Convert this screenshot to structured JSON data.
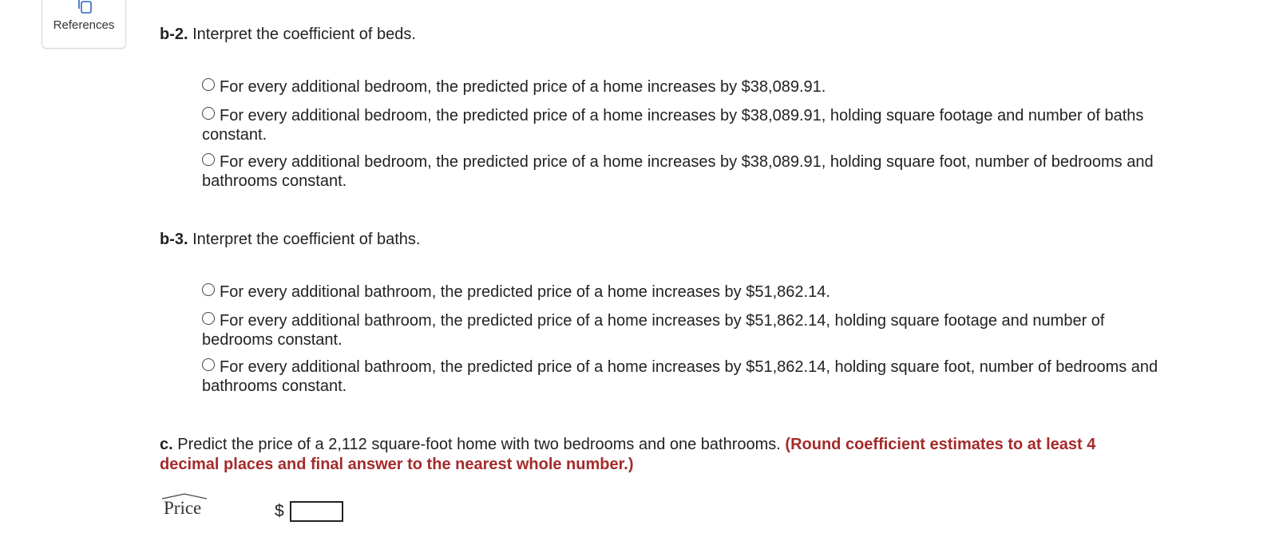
{
  "references": {
    "label": "References",
    "icon": "references-icon"
  },
  "b2": {
    "prefix": "b-2.",
    "prompt": " Interpret the coefficient of beds.",
    "options": [
      "For every additional bedroom, the predicted price of a home increases by $38,089.91.",
      "For every additional bedroom, the predicted price of a home increases by $38,089.91, holding square footage and number of baths constant.",
      "For every additional bedroom, the predicted price of a home increases by $38,089.91, holding square foot, number of bedrooms and bathrooms constant."
    ]
  },
  "b3": {
    "prefix": "b-3.",
    "prompt": " Interpret the coefficient of baths.",
    "options": [
      "For every additional bathroom, the predicted price of a home increases by $51,862.14.",
      "For every additional bathroom, the predicted price of a home increases by $51,862.14, holding square footage and number of bedrooms constant.",
      "For every additional bathroom, the predicted price of a home increases by $51,862.14, holding square foot, number of bedrooms and bathrooms constant."
    ]
  },
  "c": {
    "prefix": "c.",
    "prompt": " Predict the price of a 2,112 square-foot home with two bedrooms and one bathrooms. ",
    "instruction": "(Round coefficient estimates to at least 4 decimal places and final answer to the nearest whole number.)",
    "price_label": "Price",
    "currency": "$",
    "answer_value": ""
  },
  "colors": {
    "instruction_red": "#a52a2a"
  }
}
